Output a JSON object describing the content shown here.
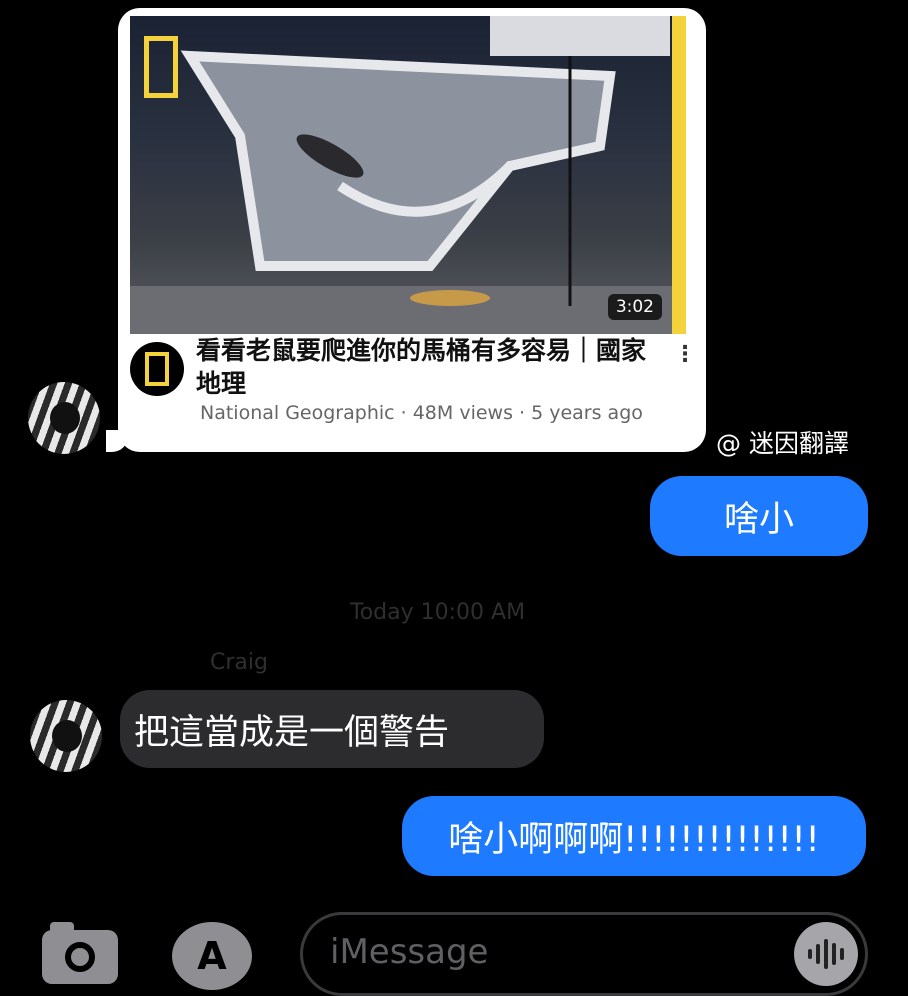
{
  "link_preview": {
    "duration": "3:02",
    "title": "看看老鼠要爬進你的馬桶有多容易｜國家地理",
    "channel": "National Geographic",
    "meta": "National Geographic · 48M views · 5 years ago"
  },
  "watermark": "@ 迷因翻譯",
  "messages": [
    {
      "side": "sent",
      "text": "啥小"
    },
    {
      "side": "received",
      "text": "把這當成是一個警告"
    },
    {
      "side": "sent",
      "text": "啥小啊啊啊!!!!!!!!!!!!!!"
    }
  ],
  "faded_timestamp": "Today 10:00 AM",
  "faded_sender": "Craig",
  "compose": {
    "placeholder": "iMessage"
  },
  "colors": {
    "sent_bubble": "#1e7bff",
    "received_bubble": "#2c2c2e",
    "ng_yellow": "#f4d23c"
  },
  "icons": [
    "camera-icon",
    "app-store-icon",
    "audio-waveform-icon",
    "more-options-icon"
  ]
}
